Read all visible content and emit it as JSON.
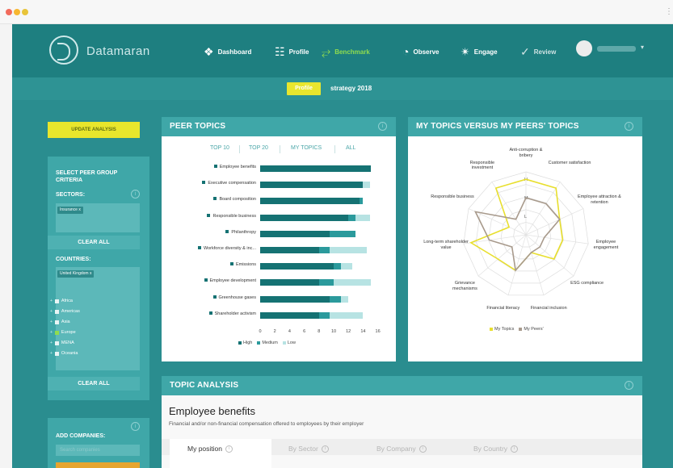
{
  "app": {
    "brand": "Datamaran",
    "nav": [
      {
        "label": "Dashboard",
        "icon": "dashboard-icon",
        "glyph": "❖"
      },
      {
        "label": "Profile",
        "icon": "profile-icon",
        "glyph": "☷"
      },
      {
        "label": "Benchmark",
        "icon": "benchmark-icon",
        "glyph": "⥂"
      },
      {
        "label": "Observe",
        "icon": "observe-icon",
        "glyph": "◔"
      },
      {
        "label": "Engage",
        "icon": "engage-icon",
        "glyph": "✴"
      },
      {
        "label": "Review",
        "icon": "review-icon",
        "glyph": "✓"
      }
    ],
    "subbar": {
      "profile_tag": "Profile",
      "strategy": "strategy 2018"
    }
  },
  "sidebar": {
    "update_button": "UPDATE ANALYSIS",
    "criteria_title": "SELECT PEER GROUP CRITERIA",
    "sectors_label": "SECTORS:",
    "sector_chip": "Insurance",
    "clear_all_1": "CLEAR ALL",
    "countries_label": "COUNTRIES:",
    "country_chip": "United Kingdom",
    "regions": [
      {
        "label": "Africa",
        "checked": false
      },
      {
        "label": "Americas",
        "checked": false
      },
      {
        "label": "Asia",
        "checked": false
      },
      {
        "label": "Europe",
        "checked": true
      },
      {
        "label": "MENA",
        "checked": false
      },
      {
        "label": "Oceania",
        "checked": false
      }
    ],
    "clear_all_2": "CLEAR ALL",
    "add_companies_label": "ADD COMPANIES:",
    "add_companies_placeholder": "Search companies"
  },
  "peer_topics": {
    "title": "PEER TOPICS",
    "tabs": [
      "TOP 10",
      "TOP 20",
      "MY TOPICS",
      "ALL"
    ],
    "legend": [
      "High",
      "Medium",
      "Low"
    ]
  },
  "radar": {
    "title": "MY TOPICS VERSUS MY PEERS' TOPICS",
    "legend": [
      "My Topics",
      "My Peers'"
    ]
  },
  "topic_analysis": {
    "title": "TOPIC ANALYSIS",
    "topic": "Employee benefits",
    "description": "Financial and/or non-financial compensation offered to employees by their employer",
    "tabs": [
      "My position",
      "By Sector",
      "By Company",
      "By Country"
    ]
  },
  "colors": {
    "high": "#157273",
    "medium": "#2b9a9c",
    "low": "#b7e3e3",
    "my_topics": "#e8df2e",
    "my_peers": "#a89a8c",
    "accent": "#e8e62c"
  },
  "chart_data": [
    {
      "type": "bar",
      "orientation": "horizontal",
      "stacked": true,
      "title": "PEER TOPICS",
      "categories": [
        "Employee benefits",
        "Executive compensation",
        "Board composition",
        "Responsible business",
        "Philanthropy",
        "Workforce diversity & inc...",
        "Emissions",
        "Employee development",
        "Greenhouse gases",
        "Shareholder activism"
      ],
      "series": [
        {
          "name": "High",
          "values": [
            15,
            14,
            13.5,
            12,
            9.5,
            8,
            10,
            8,
            9.5,
            8
          ]
        },
        {
          "name": "Medium",
          "values": [
            0,
            0,
            0.5,
            1,
            3.5,
            1.5,
            1,
            2,
            1.5,
            1.5
          ]
        },
        {
          "name": "Low",
          "values": [
            0,
            1,
            0,
            2,
            0,
            5,
            1.5,
            5,
            1,
            4.5
          ]
        }
      ],
      "xlim": [
        0,
        16
      ],
      "xticks": [
        0,
        2,
        4,
        6,
        8,
        10,
        12,
        14,
        16
      ]
    },
    {
      "type": "radar",
      "title": "MY TOPICS VERSUS MY PEERS' TOPICS",
      "axes": [
        "Anti-corruption & bribery",
        "Customer satisfaction",
        "Employee attraction & retention",
        "Employee engagement",
        "ESG compliance",
        "Financial inclusion",
        "Financial literacy",
        "Grievance mechanisms",
        "Long-term shareholder value",
        "Responsible business",
        "Responsible investment"
      ],
      "levels": [
        "H",
        "M",
        "L"
      ],
      "series": [
        {
          "name": "My Topics",
          "values": [
            3,
            3,
            2,
            2,
            2,
            1,
            2,
            2,
            3,
            1,
            3
          ]
        },
        {
          "name": "My Peers'",
          "values": [
            2,
            2,
            2,
            1,
            1,
            1,
            2,
            1,
            2,
            3,
            1
          ]
        }
      ]
    }
  ]
}
